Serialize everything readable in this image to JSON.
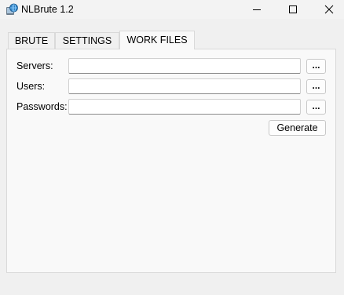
{
  "window": {
    "title": "NLBrute 1.2",
    "icon": "app-globe-icon",
    "controls": {
      "minimize_icon": "minimize-icon",
      "maximize_icon": "maximize-icon",
      "close_icon": "close-icon"
    }
  },
  "tabs": [
    {
      "label": "BRUTE",
      "active": false
    },
    {
      "label": "SETTINGS",
      "active": false
    },
    {
      "label": "WORK FILES",
      "active": true
    }
  ],
  "work_files": {
    "servers": {
      "label": "Servers:",
      "value": "",
      "browse_label": "..."
    },
    "users": {
      "label": "Users:",
      "value": "",
      "browse_label": "..."
    },
    "passwords": {
      "label": "Passwords:",
      "value": "",
      "browse_label": "..."
    },
    "generate_label": "Generate"
  },
  "colors": {
    "window_bg": "#f0f0f0",
    "panel_bg": "#f9f9f9",
    "border": "#d9d9d9"
  }
}
